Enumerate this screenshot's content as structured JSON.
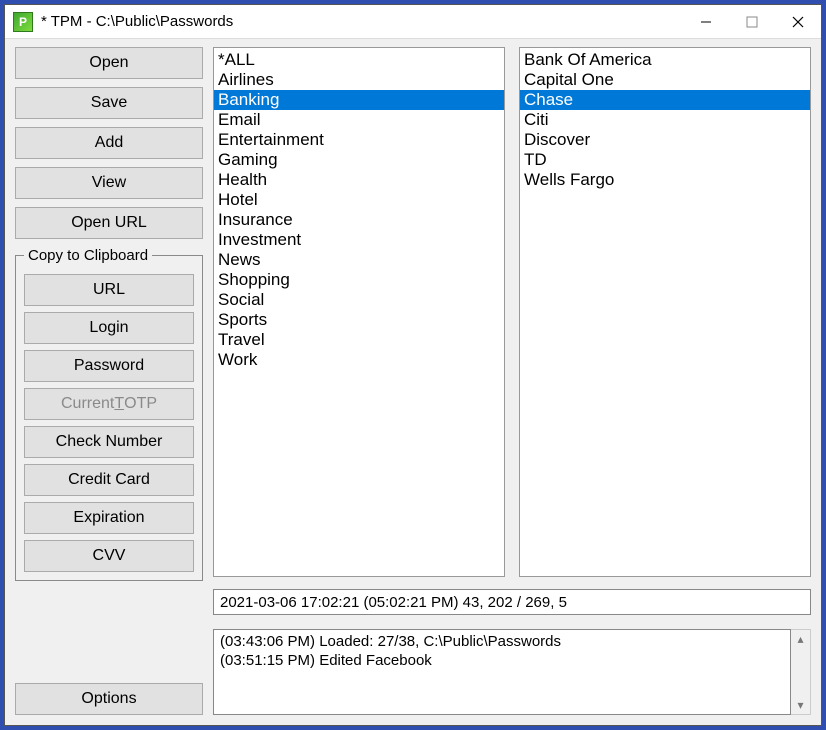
{
  "window": {
    "title": "* TPM - C:\\Public\\Passwords"
  },
  "buttons": {
    "open": "Open",
    "save": "Save",
    "add": "Add",
    "view": "View",
    "open_url": "Open URL",
    "options": "Options"
  },
  "clipboard_group": {
    "legend": "Copy to Clipboard",
    "url": "URL",
    "login": "Login",
    "password": "Password",
    "totp_pre": "Current ",
    "totp_ul": "T",
    "totp_post": "OTP",
    "check_number": "Check Number",
    "credit_card": "Credit Card",
    "expiration": "Expiration",
    "cvv": "CVV"
  },
  "categories": [
    {
      "label": "*ALL"
    },
    {
      "label": "Airlines"
    },
    {
      "label": "Banking",
      "selected": true
    },
    {
      "label": "Email"
    },
    {
      "label": "Entertainment"
    },
    {
      "label": "Gaming"
    },
    {
      "label": "Health"
    },
    {
      "label": "Hotel"
    },
    {
      "label": "Insurance"
    },
    {
      "label": "Investment"
    },
    {
      "label": "News"
    },
    {
      "label": "Shopping"
    },
    {
      "label": "Social"
    },
    {
      "label": "Sports"
    },
    {
      "label": "Travel"
    },
    {
      "label": "Work"
    }
  ],
  "entries": [
    {
      "label": "Bank Of America"
    },
    {
      "label": "Capital One"
    },
    {
      "label": "Chase",
      "selected": true
    },
    {
      "label": "Citi"
    },
    {
      "label": "Discover"
    },
    {
      "label": "TD"
    },
    {
      "label": "Wells Fargo"
    }
  ],
  "status_line": "2021-03-06 17:02:21 (05:02:21 PM)  43, 202 / 269, 5",
  "log_lines": [
    "(03:43:06 PM) Loaded: 27/38, C:\\Public\\Passwords",
    "(03:51:15 PM) Edited Facebook"
  ]
}
